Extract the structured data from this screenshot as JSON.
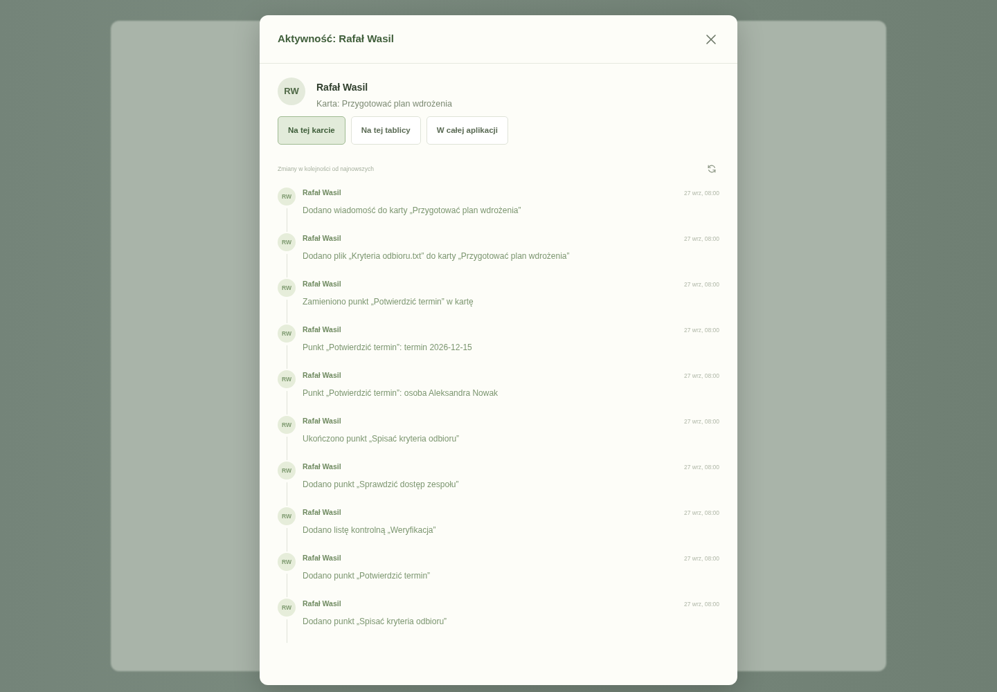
{
  "dialog": {
    "title": "Aktywność: Rafał Wasil"
  },
  "user": {
    "initials": "RW",
    "name": "Rafał Wasil",
    "context": "Karta: Przygotować plan wdrożenia"
  },
  "scopes": [
    {
      "label": "Na tej karcie",
      "selected": true
    },
    {
      "label": "Na tej tablicy",
      "selected": false
    },
    {
      "label": "W całej aplikacji",
      "selected": false
    }
  ],
  "feed_caption": "Zmiany w kolejności od najnowszych",
  "activities": [
    {
      "initials": "RW",
      "author": "Rafał Wasil",
      "time": "27 wrz, 08:00",
      "message": "Dodano wiadomość do karty „Przygotować plan wdrożenia”"
    },
    {
      "initials": "RW",
      "author": "Rafał Wasil",
      "time": "27 wrz, 08:00",
      "message": "Dodano plik „Kryteria odbioru.txt” do karty „Przygotować plan wdrożenia”"
    },
    {
      "initials": "RW",
      "author": "Rafał Wasil",
      "time": "27 wrz, 08:00",
      "message": "Zamieniono punkt „Potwierdzić termin” w kartę"
    },
    {
      "initials": "RW",
      "author": "Rafał Wasil",
      "time": "27 wrz, 08:00",
      "message": "Punkt „Potwierdzić termin”: termin 2026-12-15"
    },
    {
      "initials": "RW",
      "author": "Rafał Wasil",
      "time": "27 wrz, 08:00",
      "message": "Punkt „Potwierdzić termin”: osoba Aleksandra Nowak"
    },
    {
      "initials": "RW",
      "author": "Rafał Wasil",
      "time": "27 wrz, 08:00",
      "message": "Ukończono punkt „Spisać kryteria odbioru”"
    },
    {
      "initials": "RW",
      "author": "Rafał Wasil",
      "time": "27 wrz, 08:00",
      "message": "Dodano punkt „Sprawdzić dostęp zespołu”"
    },
    {
      "initials": "RW",
      "author": "Rafał Wasil",
      "time": "27 wrz, 08:00",
      "message": "Dodano listę kontrolną „Weryfikacja”"
    },
    {
      "initials": "RW",
      "author": "Rafał Wasil",
      "time": "27 wrz, 08:00",
      "message": "Dodano punkt „Potwierdzić termin”"
    },
    {
      "initials": "RW",
      "author": "Rafał Wasil",
      "time": "27 wrz, 08:00",
      "message": "Dodano punkt „Spisać kryteria odbioru”"
    }
  ]
}
